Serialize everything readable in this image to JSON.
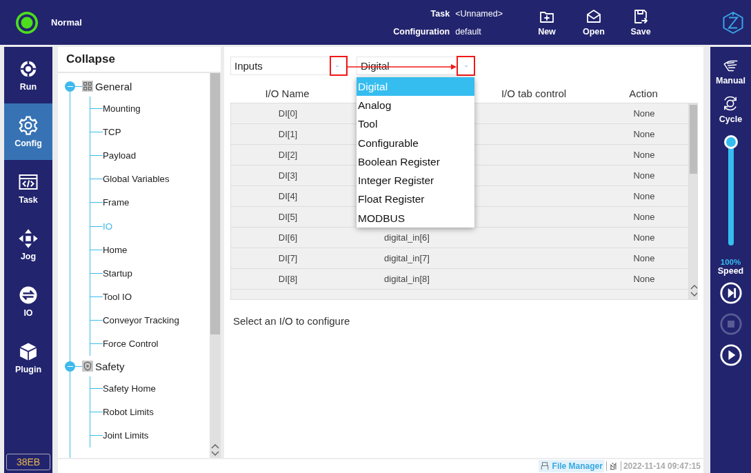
{
  "top_bar": {
    "status": "Normal",
    "task_label": "Task",
    "task_value": "<Unnamed>",
    "configuration_label": "Configuration",
    "configuration_value": "default",
    "buttons": [
      {
        "kind": "new",
        "label": "New"
      },
      {
        "kind": "open",
        "label": "Open"
      },
      {
        "kind": "save",
        "label": "Save"
      }
    ]
  },
  "navigation": {
    "items": [
      {
        "kind": "run",
        "label": "Run",
        "selected": false
      },
      {
        "kind": "config",
        "label": "Config",
        "selected": true
      },
      {
        "kind": "task",
        "label": "Task",
        "selected": false
      },
      {
        "kind": "jog",
        "label": "Jog",
        "selected": false
      },
      {
        "kind": "io",
        "label": "IO",
        "selected": false
      },
      {
        "kind": "plugin",
        "label": "Plugin",
        "selected": false
      }
    ],
    "badge": "38EB"
  },
  "tree": {
    "header": "Collapse",
    "items": [
      {
        "kind": "general",
        "label": "General",
        "expanded": true,
        "children": [
          {
            "label": "Mounting",
            "selected": false
          },
          {
            "label": "TCP",
            "selected": false
          },
          {
            "label": "Payload",
            "selected": false
          },
          {
            "label": "Global Variables",
            "selected": false
          },
          {
            "label": "Frame",
            "selected": false
          },
          {
            "label": "IO",
            "selected": true
          },
          {
            "label": "Home",
            "selected": false
          },
          {
            "label": "Startup",
            "selected": false
          },
          {
            "label": "Tool IO",
            "selected": false
          },
          {
            "label": "Conveyor Tracking",
            "selected": false
          },
          {
            "label": "Force Control",
            "selected": false
          }
        ]
      },
      {
        "kind": "safety",
        "label": "Safety",
        "expanded": true,
        "children": [
          {
            "label": "Safety Home",
            "selected": false
          },
          {
            "label": "Robot Limits",
            "selected": false
          },
          {
            "label": "Joint Limits",
            "selected": false
          }
        ]
      }
    ]
  },
  "io_panel": {
    "direction_select": "Inputs",
    "type_select": "Digital",
    "columns": {
      "io_name": "I/O Name",
      "tab_control": "I/O tab control",
      "action": "Action"
    },
    "rows": [
      {
        "name": "DI[0]",
        "action": "None"
      },
      {
        "name": "DI[1]",
        "action": "None"
      },
      {
        "name": "DI[2]",
        "action": "None"
      },
      {
        "name": "DI[3]",
        "action": "None"
      },
      {
        "name": "DI[4]",
        "action": "None"
      },
      {
        "name": "DI[5]",
        "action": "None"
      },
      {
        "name": "DI[6]",
        "column_2": "digital_in[6]",
        "action": "None"
      },
      {
        "name": "DI[7]",
        "column_2": "digital_in[7]",
        "action": "None"
      },
      {
        "name": "DI[8]",
        "column_2": "digital_in[8]",
        "action": "None"
      }
    ],
    "dropdown": [
      {
        "label": "Digital",
        "selected": true
      },
      {
        "label": "Analog",
        "selected": false
      },
      {
        "label": "Tool",
        "selected": false
      },
      {
        "label": "Configurable",
        "selected": false
      },
      {
        "label": "Boolean Register",
        "selected": false
      },
      {
        "label": "Integer Register",
        "selected": false
      },
      {
        "label": "Float Register",
        "selected": false
      },
      {
        "label": "MODBUS",
        "selected": false
      }
    ],
    "hint": "Select an I/O to configure"
  },
  "right_bar": {
    "mode": "Manual",
    "cycle": "Cycle",
    "speed": {
      "level": 1,
      "reading": "100%",
      "label": "Speed"
    },
    "controls": [
      {
        "kind": "step",
        "disabled": false
      },
      {
        "kind": "stop",
        "disabled": true
      },
      {
        "kind": "play",
        "disabled": false
      }
    ]
  },
  "status_bar": {
    "file_manager": "File Manager",
    "datetime": "2022-11-14 09:47:15"
  }
}
